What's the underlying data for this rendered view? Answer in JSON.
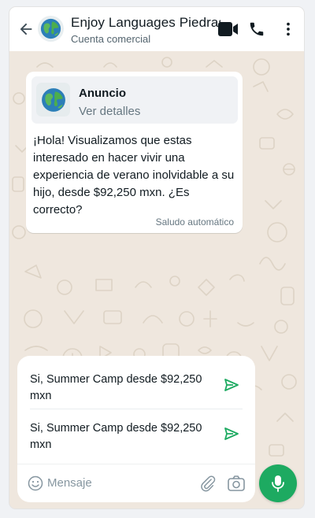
{
  "header": {
    "title": "Enjoy Languages Piedras",
    "subtitle": "Cuenta comercial",
    "icons": [
      "arrow-left-icon",
      "video-call-icon",
      "phone-icon",
      "more-vertical-icon"
    ]
  },
  "ad": {
    "title": "Anuncio",
    "link": "Ver detalles"
  },
  "message": {
    "text": "¡Hola! Visualizamos que estas interesado en hacer vivir una experiencia de verano inolvidable a su hijo, desde $92,250 mxn. ¿Es correcto?",
    "meta": "Saludo automático"
  },
  "quick_replies": [
    {
      "text": "Si, Summer Camp desde $92,250 mxn"
    },
    {
      "text": "Si, Summer Camp desde $92,250 mxn"
    }
  ],
  "compose": {
    "placeholder": "Mensaje"
  },
  "colors": {
    "accent": "#1daa61",
    "chat_background": "#efe7de",
    "secondary_text": "#667781"
  }
}
